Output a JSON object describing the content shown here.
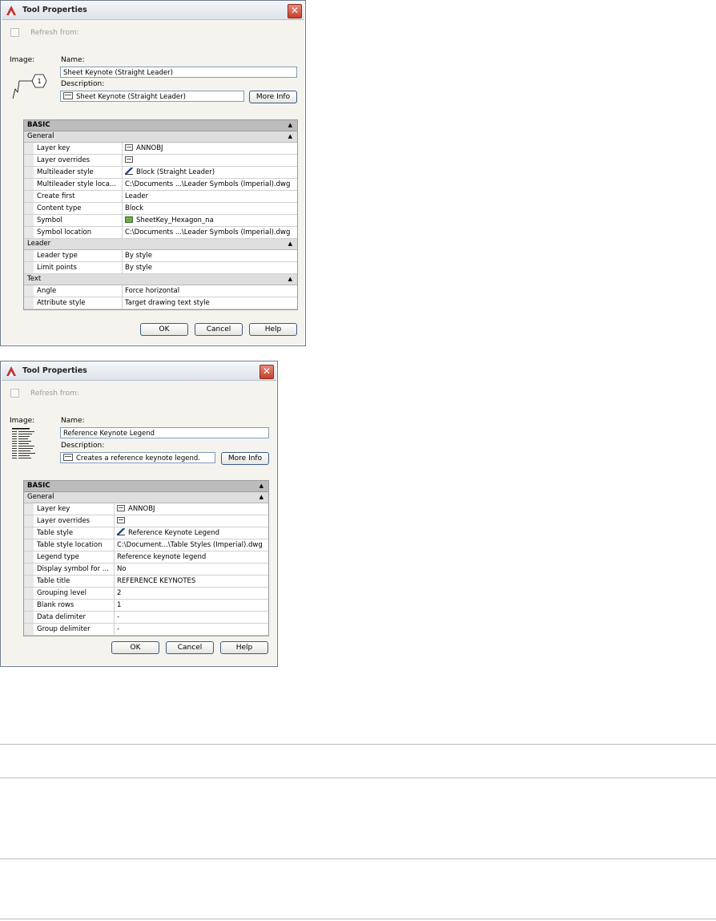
{
  "dialog1": {
    "title": "Tool Properties",
    "close": "✕",
    "refresh_label": "Refresh from:",
    "image_label": "Image:",
    "keynote_number": "1",
    "name_label": "Name:",
    "name_value": "Sheet Keynote (Straight Leader)",
    "description_label": "Description:",
    "description_value": "Sheet Keynote (Straight Leader)",
    "more_info": "More Info",
    "categories": {
      "basic": "BASIC",
      "general": "General",
      "leader": "Leader",
      "text": "Text"
    },
    "general_rows": [
      {
        "name": "Layer key",
        "value": "ANNOBJ",
        "icon": "layer-icon"
      },
      {
        "name": "Layer overrides",
        "value": "",
        "icon": "layer-icon"
      },
      {
        "name": "Multileader style",
        "value": "Block (Straight Leader)",
        "icon": "style-icon"
      },
      {
        "name": "Multileader style loca...",
        "value": "C:\\Documents ...\\Leader Symbols (Imperial).dwg"
      },
      {
        "name": "Create first",
        "value": "Leader"
      },
      {
        "name": "Content type",
        "value": "Block"
      },
      {
        "name": "Symbol",
        "value": "SheetKey_Hexagon_na",
        "icon": "symbol-icon"
      },
      {
        "name": "Symbol location",
        "value": "C:\\Documents ...\\Leader Symbols (Imperial).dwg"
      }
    ],
    "leader_rows": [
      {
        "name": "Leader type",
        "value": "By style"
      },
      {
        "name": "Limit points",
        "value": "By style"
      }
    ],
    "text_rows": [
      {
        "name": "Angle",
        "value": "Force horizontal"
      },
      {
        "name": "Attribute style",
        "value": "Target drawing text style"
      }
    ],
    "ok": "OK",
    "cancel": "Cancel",
    "help": "Help"
  },
  "dialog2": {
    "title": "Tool Properties",
    "close": "✕",
    "refresh_label": "Refresh from:",
    "image_label": "Image:",
    "name_label": "Name:",
    "name_value": "Reference Keynote Legend",
    "description_label": "Description:",
    "description_value": "Creates a reference keynote legend.",
    "more_info": "More Info",
    "categories": {
      "basic": "BASIC",
      "general": "General"
    },
    "general_rows": [
      {
        "name": "Layer key",
        "value": "ANNOBJ",
        "icon": "layer-icon"
      },
      {
        "name": "Layer overrides",
        "value": "",
        "icon": "layer-icon"
      },
      {
        "name": "Table style",
        "value": "Reference Keynote Legend",
        "icon": "style-icon"
      },
      {
        "name": "Table style location",
        "value": "C:\\Document...\\Table Styles (Imperial).dwg"
      },
      {
        "name": "Legend type",
        "value": "Reference keynote legend"
      },
      {
        "name": "Display symbol for ...",
        "value": "No"
      },
      {
        "name": "Table title",
        "value": "REFERENCE KEYNOTES"
      },
      {
        "name": "Grouping level",
        "value": "2"
      },
      {
        "name": "Blank rows",
        "value": "1"
      },
      {
        "name": "Data delimiter",
        "value": "-"
      },
      {
        "name": "Group delimiter",
        "value": "-"
      }
    ],
    "ok": "OK",
    "cancel": "Cancel",
    "help": "Help"
  },
  "colors": {
    "accent": "#3c5a86",
    "category_header": "#bcbcbc",
    "section_header": "#dedede",
    "dialog_bg": "#f4f3ee"
  }
}
